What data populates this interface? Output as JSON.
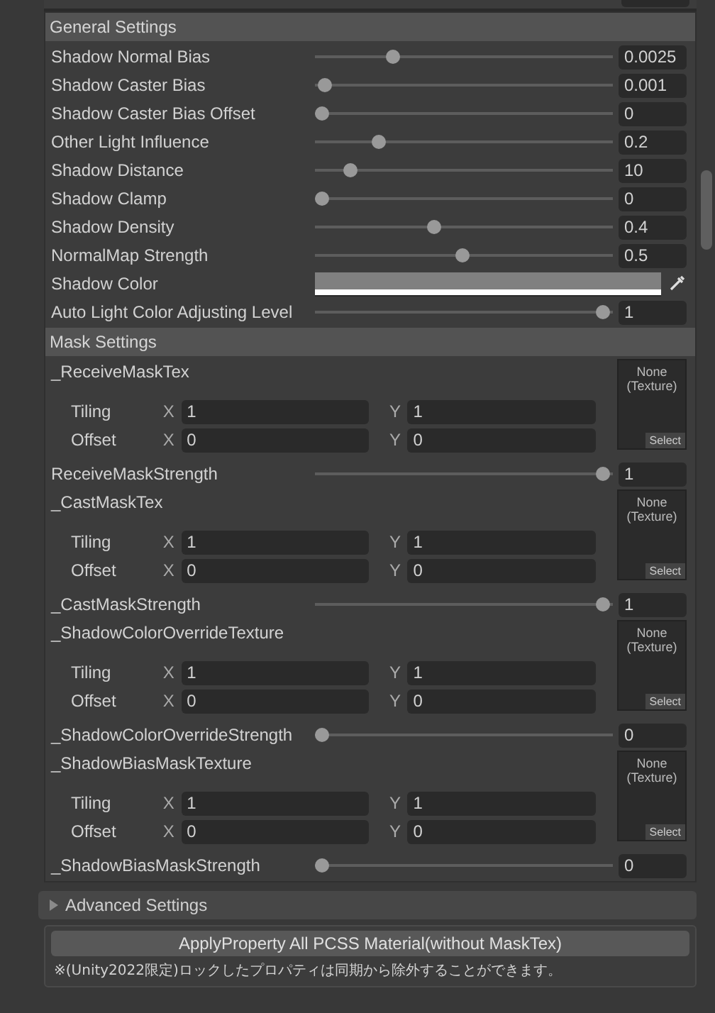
{
  "general": {
    "title": "General Settings",
    "rows": [
      {
        "kind": "slider",
        "label": "Shadow Normal Bias",
        "level": 0.25,
        "value": "0.0025"
      },
      {
        "kind": "slider",
        "label": "Shadow Caster Bias",
        "level": 0.01,
        "value": "0.001"
      },
      {
        "kind": "slider",
        "label": "Shadow Caster Bias Offset",
        "level": 0,
        "value": "0"
      },
      {
        "kind": "slider",
        "label": "Other Light Influence",
        "level": 0.2,
        "value": "0.2"
      },
      {
        "kind": "slider",
        "label": "Shadow Distance",
        "level": 0.1,
        "value": "10"
      },
      {
        "kind": "slider",
        "label": "Shadow Clamp",
        "level": 0,
        "value": "0"
      },
      {
        "kind": "slider",
        "label": "Shadow Density",
        "level": 0.4,
        "value": "0.4"
      },
      {
        "kind": "slider",
        "label": "NormalMap Strength",
        "level": 0.5,
        "value": "0.5"
      },
      {
        "kind": "color",
        "label": "Shadow Color",
        "color": "#808080"
      },
      {
        "kind": "slider",
        "label": "Auto Light Color Adjusting Level",
        "level": 1,
        "value": "1"
      }
    ]
  },
  "mask": {
    "title": "Mask Settings",
    "rows": [
      {
        "kind": "texture",
        "label": "_ReceiveMaskTex",
        "tiling": "Tiling",
        "x_label": "X",
        "y_label": "Y",
        "offset": "Offset",
        "x_label2": "X",
        "y_label2": "Y",
        "tx": "1",
        "ty": "1",
        "ox": "0",
        "oy": "0",
        "thumb": "None (Texture)",
        "select": "Select"
      },
      {
        "kind": "slider",
        "label": "ReceiveMaskStrength",
        "level": 1,
        "value": "1"
      },
      {
        "kind": "texture",
        "label": "_CastMaskTex",
        "tiling": "Tiling",
        "x_label": "X",
        "y_label": "Y",
        "offset": "Offset",
        "x_label2": "X",
        "y_label2": "Y",
        "tx": "1",
        "ty": "1",
        "ox": "0",
        "oy": "0",
        "thumb": "None (Texture)",
        "select": "Select"
      },
      {
        "kind": "slider",
        "label": "_CastMaskStrength",
        "level": 1,
        "value": "1"
      },
      {
        "kind": "texture",
        "label": "_ShadowColorOverrideTexture",
        "tiling": "Tiling",
        "x_label": "X",
        "y_label": "Y",
        "offset": "Offset",
        "x_label2": "X",
        "y_label2": "Y",
        "tx": "1",
        "ty": "1",
        "ox": "0",
        "oy": "0",
        "thumb": "None (Texture)",
        "select": "Select"
      },
      {
        "kind": "slider",
        "label": "_ShadowColorOverrideStrength",
        "level": 0,
        "value": "0"
      },
      {
        "kind": "texture",
        "label": "_ShadowBiasMaskTexture",
        "tiling": "Tiling",
        "x_label": "X",
        "y_label": "Y",
        "offset": "Offset",
        "x_label2": "X",
        "y_label2": "Y",
        "tx": "1",
        "ty": "1",
        "ox": "0",
        "oy": "0",
        "thumb": "None (Texture)",
        "select": "Select"
      },
      {
        "kind": "slider",
        "label": "_ShadowBiasMaskStrength",
        "level": 0,
        "value": "0"
      }
    ]
  },
  "advanced": {
    "title": "Advanced Settings",
    "expanded": false
  },
  "apply_button": "ApplyProperty All PCSS Material(without MaskTex)",
  "note": "※(Unity2022限定)ロックしたプロパティは同期から除外することができます。"
}
